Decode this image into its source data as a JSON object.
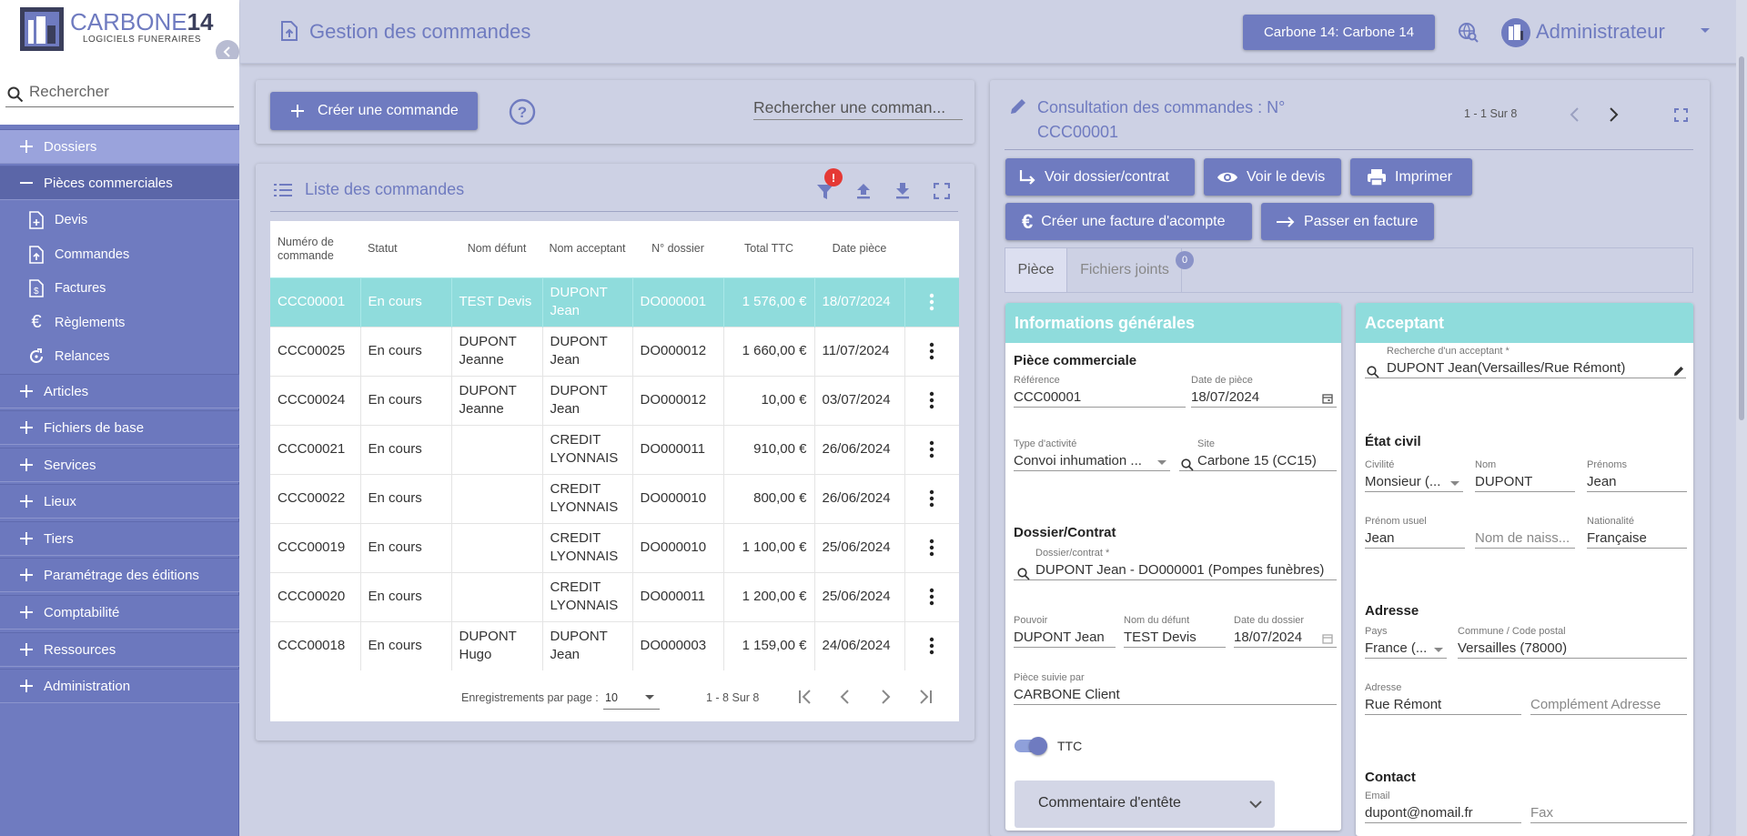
{
  "brand": {
    "name_part1": "CARBONE",
    "name_part2": "14",
    "subtitle": "LOGICIELS FUNERAIRES",
    "accent": "#6f7bc0",
    "selected": "#8fdcdc"
  },
  "sidebar": {
    "search_placeholder": "Rechercher",
    "items": [
      {
        "label": "Dossiers",
        "state": "active"
      },
      {
        "label": "Pièces commerciales",
        "state": "open"
      },
      {
        "label": "Devis",
        "icon": "file-plus-icon"
      },
      {
        "label": "Commandes",
        "icon": "file-upload-icon"
      },
      {
        "label": "Factures",
        "icon": "file-dollar-icon"
      },
      {
        "label": "Règlements",
        "icon": "euro-icon"
      },
      {
        "label": "Relances",
        "icon": "refresh-icon"
      },
      {
        "label": "Articles"
      },
      {
        "label": "Fichiers de base"
      },
      {
        "label": "Services"
      },
      {
        "label": "Lieux"
      },
      {
        "label": "Tiers"
      },
      {
        "label": "Paramétrage des éditions"
      },
      {
        "label": "Comptabilité"
      },
      {
        "label": "Ressources"
      },
      {
        "label": "Administration"
      }
    ]
  },
  "header": {
    "title": "Gestion des commandes",
    "company": "Carbone 14: Carbone 14",
    "user": "Administrateur"
  },
  "toolbar": {
    "create_label": "Créer une commande",
    "search_placeholder": "Rechercher une comman..."
  },
  "list": {
    "title": "Liste des commandes",
    "filter_badge": "!",
    "columns": [
      "Numéro de commande",
      "Statut",
      "Nom défunt",
      "Nom acceptant",
      "N° dossier",
      "Total TTC",
      "Date pièce"
    ],
    "rows": [
      {
        "num": "CCC00001",
        "statut": "En cours",
        "defunt": "TEST Devis",
        "acceptant": "DUPONT Jean",
        "dossier": "DO000001",
        "total": "1 576,00 €",
        "date": "18/07/2024"
      },
      {
        "num": "CCC00025",
        "statut": "En cours",
        "defunt": "DUPONT Jeanne",
        "acceptant": "DUPONT Jean",
        "dossier": "DO000012",
        "total": "1 660,00 €",
        "date": "11/07/2024"
      },
      {
        "num": "CCC00024",
        "statut": "En cours",
        "defunt": "DUPONT Jeanne",
        "acceptant": "DUPONT Jean",
        "dossier": "DO000012",
        "total": "10,00 €",
        "date": "03/07/2024"
      },
      {
        "num": "CCC00021",
        "statut": "En cours",
        "defunt": "",
        "acceptant": "CREDIT LYONNAIS",
        "dossier": "DO000011",
        "total": "910,00 €",
        "date": "26/06/2024"
      },
      {
        "num": "CCC00022",
        "statut": "En cours",
        "defunt": "",
        "acceptant": "CREDIT LYONNAIS",
        "dossier": "DO000010",
        "total": "800,00 €",
        "date": "26/06/2024"
      },
      {
        "num": "CCC00019",
        "statut": "En cours",
        "defunt": "",
        "acceptant": "CREDIT LYONNAIS",
        "dossier": "DO000010",
        "total": "1 100,00 €",
        "date": "25/06/2024"
      },
      {
        "num": "CCC00020",
        "statut": "En cours",
        "defunt": "",
        "acceptant": "CREDIT LYONNAIS",
        "dossier": "DO000011",
        "total": "1 200,00 €",
        "date": "25/06/2024"
      },
      {
        "num": "CCC00018",
        "statut": "En cours",
        "defunt": "DUPONT Hugo",
        "acceptant": "DUPONT Jean",
        "dossier": "DO000003",
        "total": "1 159,00 €",
        "date": "24/06/2024"
      }
    ],
    "pager": {
      "per_page_label": "Enregistrements par page :",
      "per_page": "10",
      "range": "1 - 8 Sur 8"
    }
  },
  "consultation": {
    "title": "Consultation des commandes : N° CCC00001",
    "range": "1 - 1 Sur 8",
    "buttons": {
      "voir_dossier": "Voir dossier/contrat",
      "voir_devis": "Voir le devis",
      "imprimer": "Imprimer",
      "facture_acompte": "Créer une facture d'acompte",
      "passer_facture": "Passer en facture"
    },
    "tabs": {
      "piece": "Pièce",
      "fichiers": "Fichiers joints",
      "fichiers_count": "0"
    },
    "infos": {
      "header": "Informations générales",
      "piece_title": "Pièce commerciale",
      "reference_label": "Référence",
      "reference": "CCC00001",
      "date_label": "Date de pièce",
      "date": "18/07/2024",
      "activite_label": "Type d'activité",
      "activite": "Convoi inhumation ...",
      "site_label": "Site",
      "site": "Carbone 15 (CC15)",
      "dossier_title": "Dossier/Contrat",
      "dossier_label": "Dossier/contrat *",
      "dossier": "DUPONT Jean - DO000001 (Pompes funèbres)",
      "pouvoir_label": "Pouvoir",
      "pouvoir": "DUPONT Jean",
      "defunt_label": "Nom du défunt",
      "defunt": "TEST Devis",
      "date_dossier_label": "Date du dossier",
      "date_dossier": "18/07/2024",
      "suivie_label": "Pièce suivie par",
      "suivie": "CARBONE Client",
      "ttc_label": "TTC",
      "comment_label": "Commentaire d'entête"
    },
    "acceptant": {
      "header": "Acceptant",
      "search_label": "Recherche d'un acceptant *",
      "search": "DUPONT Jean(Versailles/Rue Rémont)",
      "etat_title": "État civil",
      "civilite_label": "Civilité",
      "civilite": "Monsieur (...",
      "nom_label": "Nom",
      "nom": "DUPONT",
      "prenoms_label": "Prénoms",
      "prenoms": "Jean",
      "prenom_usuel_label": "Prénom usuel",
      "prenom_usuel": "Jean",
      "naissance_placeholder": "Nom de naiss...",
      "nationalite_label": "Nationalité",
      "nationalite": "Française",
      "adresse_title": "Adresse",
      "pays_label": "Pays",
      "pays": "France (...",
      "commune_label": "Commune / Code postal",
      "commune": "Versailles (78000)",
      "adresse_label": "Adresse",
      "adresse": "Rue Rémont",
      "complement_placeholder": "Complément Adresse",
      "contact_title": "Contact",
      "email_label": "Email",
      "email": "dupont@nomail.fr",
      "fax_placeholder": "Fax"
    }
  }
}
